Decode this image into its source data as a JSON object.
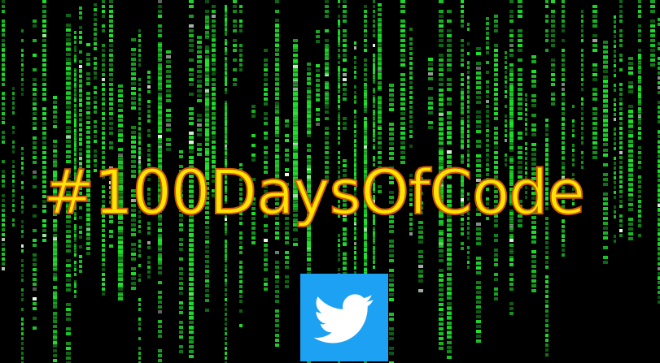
{
  "headline": "#100DaysOfCode",
  "colors": {
    "background": "#000000",
    "rain": "#1ee32a",
    "headline_fill": "#ffe600",
    "headline_outline": "#d15a0a",
    "twitter_blue": "#1da1f2"
  },
  "icons": {
    "logo": "twitter-bird-icon"
  }
}
